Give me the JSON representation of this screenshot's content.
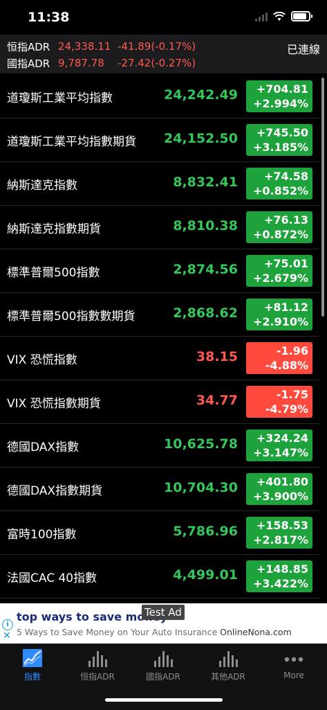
{
  "status": {
    "time": "11:38"
  },
  "adr": {
    "rows": [
      {
        "name": "恒指ADR",
        "price": "24,338.11",
        "change": "-41.89(-0.17%)"
      },
      {
        "name": "國指ADR",
        "price": "9,787.78",
        "change": "-27.42(-0.27%)"
      }
    ],
    "connection": "已連線"
  },
  "list": [
    {
      "name": "道瓊斯工業平均指數",
      "price": "24,242.49",
      "change": "+704.81",
      "pct": "+2.994%",
      "dir": "up"
    },
    {
      "name": "道瓊斯工業平均指數期貨",
      "price": "24,152.50",
      "change": "+745.50",
      "pct": "+3.185%",
      "dir": "up"
    },
    {
      "name": "納斯達克指數",
      "price": "8,832.41",
      "change": "+74.58",
      "pct": "+0.852%",
      "dir": "up"
    },
    {
      "name": "納斯達克指數期貨",
      "price": "8,810.38",
      "change": "+76.13",
      "pct": "+0.872%",
      "dir": "up"
    },
    {
      "name": "標準普爾500指數",
      "price": "2,874.56",
      "change": "+75.01",
      "pct": "+2.679%",
      "dir": "up"
    },
    {
      "name": "標準普爾500指數數期貨",
      "price": "2,868.62",
      "change": "+81.12",
      "pct": "+2.910%",
      "dir": "up"
    },
    {
      "name": "VIX 恐慌指數",
      "price": "38.15",
      "change": "-1.96",
      "pct": "-4.88%",
      "dir": "down"
    },
    {
      "name": "VIX 恐慌指數期貨",
      "price": "34.77",
      "change": "-1.75",
      "pct": "-4.79%",
      "dir": "down"
    },
    {
      "name": "德國DAX指數",
      "price": "10,625.78",
      "change": "+324.24",
      "pct": "+3.147%",
      "dir": "up"
    },
    {
      "name": "德國DAX指數期貨",
      "price": "10,704.30",
      "change": "+401.80",
      "pct": "+3.900%",
      "dir": "up"
    },
    {
      "name": "富時100指數",
      "price": "5,786.96",
      "change": "+158.53",
      "pct": "+2.817%",
      "dir": "up"
    },
    {
      "name": "法國CAC 40指數",
      "price": "4,499.01",
      "change": "+148.85",
      "pct": "+3.422%",
      "dir": "up"
    }
  ],
  "ad": {
    "title": "top ways to save money",
    "subtitle": "5 Ways to Save Money on Your Auto Insurance",
    "domain": "OnlineNona.com",
    "tag": "Test Ad"
  },
  "tabs": [
    {
      "label": "指數",
      "icon": "line-chart-icon",
      "active": true
    },
    {
      "label": "恒指ADR",
      "icon": "bar-chart-icon",
      "active": false
    },
    {
      "label": "國指ADR",
      "icon": "bar-chart-icon",
      "active": false
    },
    {
      "label": "其他ADR",
      "icon": "bar-chart-icon",
      "active": false
    },
    {
      "label": "More",
      "icon": "more-dots-icon",
      "active": false
    }
  ],
  "colors": {
    "up": "#1ea23b",
    "down": "#ff4a3d",
    "active_tab": "#2f8cff"
  }
}
